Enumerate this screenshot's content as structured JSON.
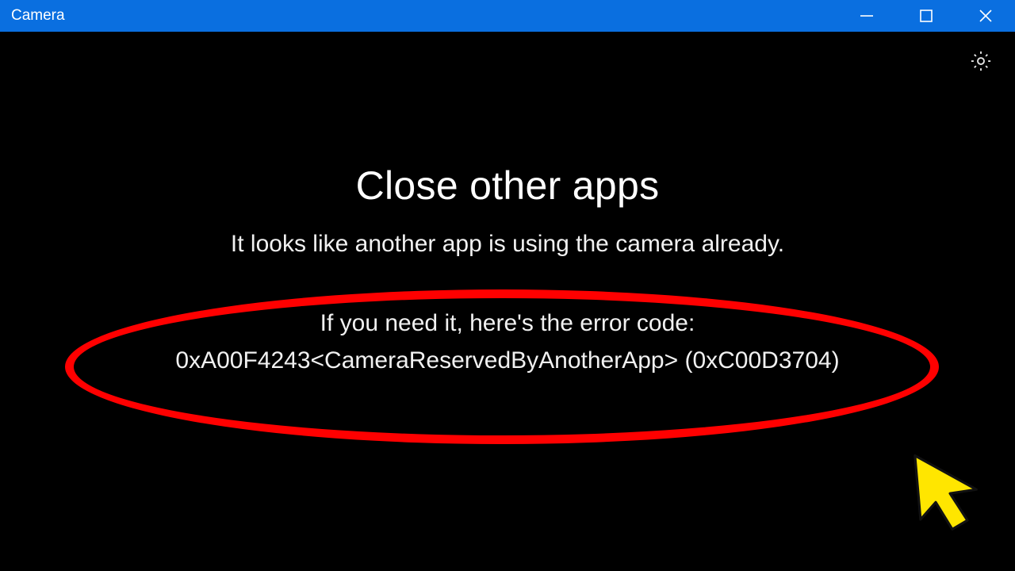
{
  "window": {
    "title": "Camera"
  },
  "icons": {
    "minimize": "minimize-icon",
    "maximize": "maximize-icon",
    "close": "close-icon",
    "settings": "gear-icon"
  },
  "error": {
    "heading": "Close other apps",
    "message": "It looks like another app is using the camera already.",
    "detail_intro": "If you need it, here's the error code:",
    "code": "0xA00F4243<CameraReservedByAnotherApp> (0xC00D3704)"
  },
  "annotation": {
    "ellipse_color": "#ff0000",
    "arrow_color": "#ffe600"
  }
}
